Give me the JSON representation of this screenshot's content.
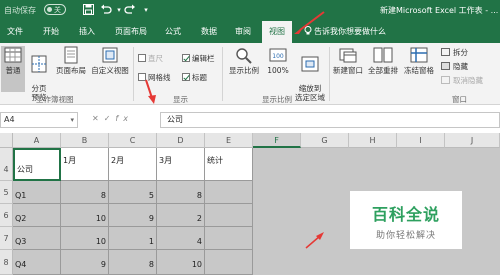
{
  "window": {
    "autosave_label": "自动保存",
    "autosave_state": "关",
    "title": "新建Microsoft Excel 工作表 - ..."
  },
  "tabs": [
    {
      "label": "文件"
    },
    {
      "label": "开始"
    },
    {
      "label": "插入"
    },
    {
      "label": "页面布局"
    },
    {
      "label": "公式"
    },
    {
      "label": "数据"
    },
    {
      "label": "审阅"
    },
    {
      "label": "视图",
      "active": true
    }
  ],
  "tell_me": "告诉我你想要做什么",
  "ribbon": {
    "workbook_views": {
      "normal": "普通",
      "page_break": "分页\n预览",
      "page_layout": "页面布局",
      "custom_views": "自定义视图",
      "group_label": "工作簿视图"
    },
    "show": {
      "ruler": "直尺",
      "formula_bar": "编辑栏",
      "gridlines": "网格线",
      "headings": "标题",
      "gridlines_checked": false,
      "formula_bar_checked": true,
      "headings_checked": true,
      "group_label": "显示"
    },
    "zoom": {
      "zoom": "显示比例",
      "zoom100": "100%",
      "zoom_selection": "缩放到\n选定区域",
      "group_label": "显示比例"
    },
    "window": {
      "new_window": "新建窗口",
      "arrange_all": "全部重排",
      "freeze_panes": "冻结窗格",
      "split": "拆分",
      "hide": "隐藏",
      "unhide": "取消隐藏",
      "group_label": "窗口"
    }
  },
  "formula_bar": {
    "name_box": "A4",
    "fx": "fx",
    "content": "公司"
  },
  "sheet": {
    "columns": [
      "A",
      "B",
      "C",
      "D",
      "E",
      "F",
      "G",
      "H",
      "I",
      "J"
    ],
    "rows": [
      "4",
      "5",
      "6",
      "7",
      "8"
    ],
    "cells": [
      [
        "公司",
        "1月",
        "2月",
        "3月",
        "统计"
      ],
      [
        "Q1",
        "8",
        "5",
        "8",
        ""
      ],
      [
        "Q2",
        "10",
        "9",
        "2",
        ""
      ],
      [
        "Q3",
        "10",
        "1",
        "4",
        ""
      ],
      [
        "Q4",
        "9",
        "8",
        "10",
        ""
      ]
    ]
  },
  "watermark": {
    "line1": "百科全说",
    "line2": "助你轻松解决"
  },
  "colors": {
    "excel_green": "#217346",
    "annotation_red": "#e53935"
  }
}
